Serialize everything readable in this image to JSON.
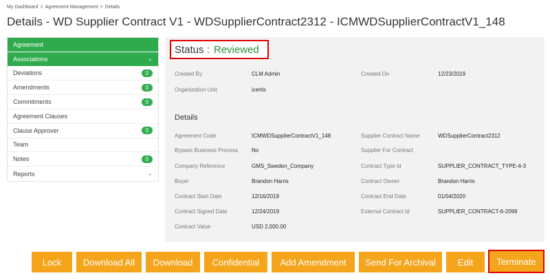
{
  "breadcrumb": [
    "My Dashboard",
    "Agreement Management",
    "Details"
  ],
  "page_title": "Details - WD Supplier Contract V1 - WDSupplierContract2312 - ICMWDSupplierContractV1_148",
  "sidebar": {
    "items": [
      {
        "label": "Agreement"
      },
      {
        "label": "Associations",
        "icon": "chevron-down-icon"
      },
      {
        "label": "Deviations",
        "badge": "0"
      },
      {
        "label": "Amendments",
        "badge": "0"
      },
      {
        "label": "Commitments",
        "badge": "0"
      },
      {
        "label": "Agreement Clauses"
      },
      {
        "label": "Clause Approver",
        "badge": "0"
      },
      {
        "label": "Team"
      },
      {
        "label": "Notes",
        "badge": "0"
      },
      {
        "label": "Reports",
        "icon": "chevron-down-icon"
      }
    ]
  },
  "status": {
    "label": "Status :",
    "value": "Reviewed"
  },
  "summary": {
    "created_by_label": "Created By",
    "created_by": "CLM Admin",
    "created_on_label": "Created On",
    "created_on": "12/23/2019",
    "org_unit_label": "Organization Unit",
    "org_unit": "icertis"
  },
  "details": {
    "title": "Details",
    "left": [
      {
        "label": "Agreement Code",
        "value": "ICMWDSupplierContractV1_148"
      },
      {
        "label": "Bypass Business Process",
        "value": "No"
      },
      {
        "label": "Company Reference",
        "value": "GMS_Sweden_Company"
      },
      {
        "label": "Buyer",
        "value": "Brandon Harris"
      },
      {
        "label": "Contract Start Date",
        "value": "12/16/2019"
      },
      {
        "label": "Contract Signed Date",
        "value": "12/24/2019"
      },
      {
        "label": "Contract Value",
        "value": "USD 2,000.00"
      }
    ],
    "right": [
      {
        "label": "Supplier Contract Name",
        "value": "WDSupplierContract2312"
      },
      {
        "label": "Supplier For Contract",
        "value": ""
      },
      {
        "label": "Contract Type Id",
        "value": "SUPPLIER_CONTRACT_TYPE-4-3"
      },
      {
        "label": "Contract Owner",
        "value": "Brandon Harris"
      },
      {
        "label": "Contract End Date",
        "value": "01/04/2020"
      },
      {
        "label": "External Contract Id",
        "value": "SUPPLIER_CONTRACT-6-2099"
      }
    ]
  },
  "actions": [
    "Lock",
    "Download All",
    "Download",
    "Confidential",
    "Add Amendment",
    "Send For Archival",
    "Edit",
    "Terminate"
  ],
  "colors": {
    "accent_green": "#2fab4e",
    "status_green": "#2e8b3e",
    "button_orange": "#f4a51c",
    "highlight_red": "#e00000"
  }
}
